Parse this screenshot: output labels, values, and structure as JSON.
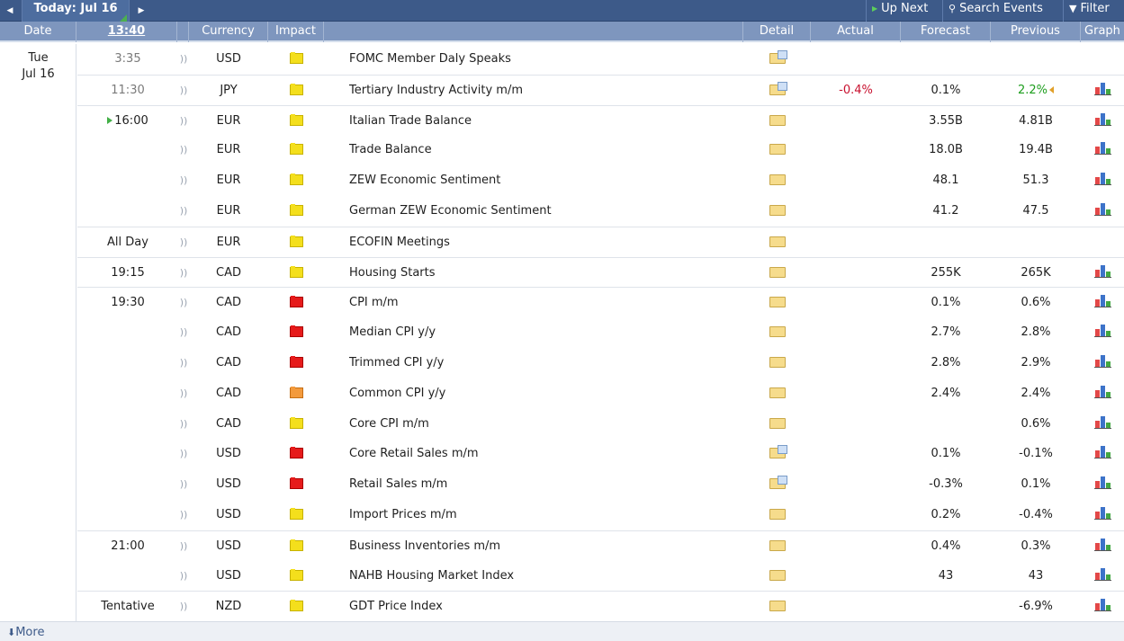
{
  "toolbar": {
    "prev_icon": "◀",
    "next_icon": "▶",
    "date_label": "Today: Jul 16",
    "up_next_label": "Up Next",
    "search_label": "Search Events",
    "filter_label": "Filter"
  },
  "columns": {
    "date": "Date",
    "time": "13:40",
    "currency": "Currency",
    "impact": "Impact",
    "detail": "Detail",
    "actual": "Actual",
    "forecast": "Forecast",
    "previous": "Previous",
    "graph": "Graph"
  },
  "day": {
    "weekday": "Tue",
    "date": "Jul 16"
  },
  "events": [
    {
      "time": "3:35",
      "currency": "USD",
      "impact": "yellow",
      "event": "FOMC Member Daly Speaks",
      "detail": "doc",
      "actual": "",
      "forecast": "",
      "previous": "",
      "graph": false
    },
    {
      "time": "11:30",
      "currency": "JPY",
      "impact": "yellow",
      "event": "Tertiary Industry Activity m/m",
      "detail": "doc",
      "actual": "-0.4%",
      "forecast": "0.1%",
      "previous": "2.2%",
      "graph": true
    },
    {
      "time": "16:00",
      "currency": "EUR",
      "impact": "yellow",
      "event": "Italian Trade Balance",
      "detail": "plain",
      "actual": "",
      "forecast": "3.55B",
      "previous": "4.81B",
      "graph": true
    },
    {
      "time": "",
      "currency": "EUR",
      "impact": "yellow",
      "event": "Trade Balance",
      "detail": "plain",
      "actual": "",
      "forecast": "18.0B",
      "previous": "19.4B",
      "graph": true
    },
    {
      "time": "",
      "currency": "EUR",
      "impact": "yellow",
      "event": "ZEW Economic Sentiment",
      "detail": "plain",
      "actual": "",
      "forecast": "48.1",
      "previous": "51.3",
      "graph": true
    },
    {
      "time": "",
      "currency": "EUR",
      "impact": "yellow",
      "event": "German ZEW Economic Sentiment",
      "detail": "plain",
      "actual": "",
      "forecast": "41.2",
      "previous": "47.5",
      "graph": true
    },
    {
      "time": "All Day",
      "currency": "EUR",
      "impact": "yellow",
      "event": "ECOFIN Meetings",
      "detail": "plain",
      "actual": "",
      "forecast": "",
      "previous": "",
      "graph": false
    },
    {
      "time": "19:15",
      "currency": "CAD",
      "impact": "yellow",
      "event": "Housing Starts",
      "detail": "plain",
      "actual": "",
      "forecast": "255K",
      "previous": "265K",
      "graph": true
    },
    {
      "time": "19:30",
      "currency": "CAD",
      "impact": "red",
      "event": "CPI m/m",
      "detail": "plain",
      "actual": "",
      "forecast": "0.1%",
      "previous": "0.6%",
      "graph": true
    },
    {
      "time": "",
      "currency": "CAD",
      "impact": "red",
      "event": "Median CPI y/y",
      "detail": "plain",
      "actual": "",
      "forecast": "2.7%",
      "previous": "2.8%",
      "graph": true
    },
    {
      "time": "",
      "currency": "CAD",
      "impact": "red",
      "event": "Trimmed CPI y/y",
      "detail": "plain",
      "actual": "",
      "forecast": "2.8%",
      "previous": "2.9%",
      "graph": true
    },
    {
      "time": "",
      "currency": "CAD",
      "impact": "orange",
      "event": "Common CPI y/y",
      "detail": "plain",
      "actual": "",
      "forecast": "2.4%",
      "previous": "2.4%",
      "graph": true
    },
    {
      "time": "",
      "currency": "CAD",
      "impact": "yellow",
      "event": "Core CPI m/m",
      "detail": "plain",
      "actual": "",
      "forecast": "",
      "previous": "0.6%",
      "graph": true
    },
    {
      "time": "",
      "currency": "USD",
      "impact": "red",
      "event": "Core Retail Sales m/m",
      "detail": "doc",
      "actual": "",
      "forecast": "0.1%",
      "previous": "-0.1%",
      "graph": true
    },
    {
      "time": "",
      "currency": "USD",
      "impact": "red",
      "event": "Retail Sales m/m",
      "detail": "doc",
      "actual": "",
      "forecast": "-0.3%",
      "previous": "0.1%",
      "graph": true
    },
    {
      "time": "",
      "currency": "USD",
      "impact": "yellow",
      "event": "Import Prices m/m",
      "detail": "plain",
      "actual": "",
      "forecast": "0.2%",
      "previous": "-0.4%",
      "graph": true
    },
    {
      "time": "21:00",
      "currency": "USD",
      "impact": "yellow",
      "event": "Business Inventories m/m",
      "detail": "plain",
      "actual": "",
      "forecast": "0.4%",
      "previous": "0.3%",
      "graph": true
    },
    {
      "time": "",
      "currency": "USD",
      "impact": "yellow",
      "event": "NAHB Housing Market Index",
      "detail": "plain",
      "actual": "",
      "forecast": "43",
      "previous": "43",
      "graph": true
    },
    {
      "time": "Tentative",
      "currency": "NZD",
      "impact": "yellow",
      "event": "GDT Price Index",
      "detail": "plain",
      "actual": "",
      "forecast": "",
      "previous": "-6.9%",
      "graph": true
    }
  ],
  "footer": {
    "more_label": "More"
  },
  "colors": {
    "header_bg": "#3d5a89",
    "column_header_bg": "#7e96be",
    "actual_worse": "#c8102e",
    "previous_better": "#1e9e1e"
  }
}
